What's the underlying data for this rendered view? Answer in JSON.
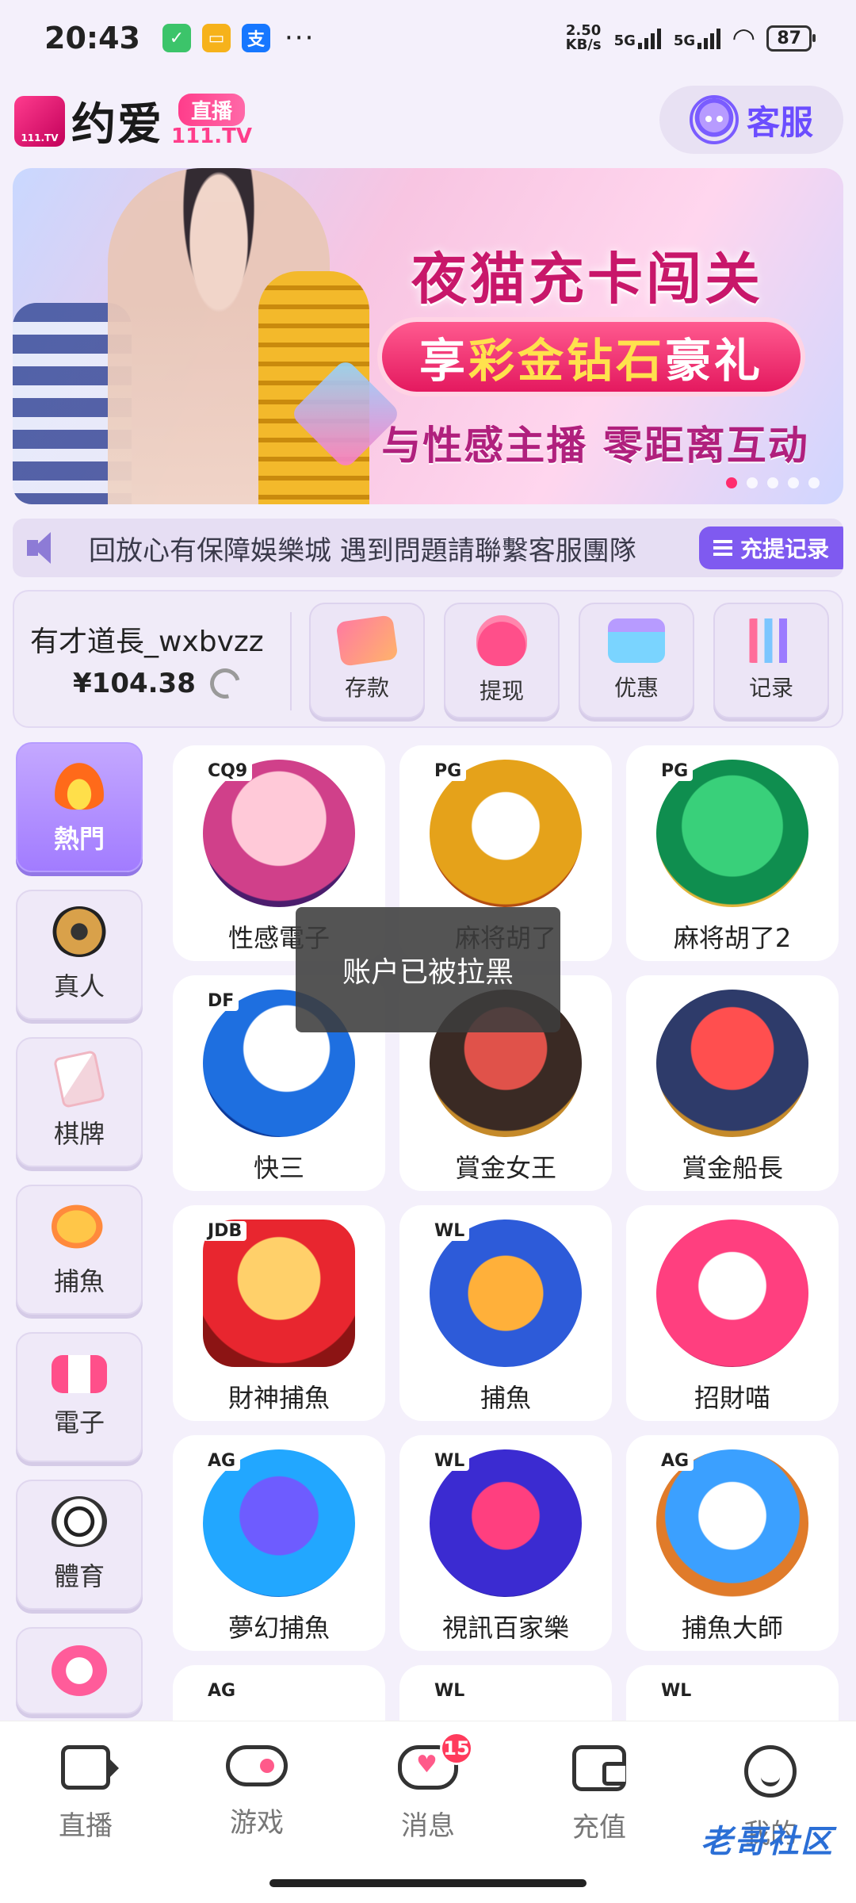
{
  "status_bar": {
    "time": "20:43",
    "dots": "···",
    "speed_value": "2.50",
    "speed_unit": "KB/s",
    "net1": "5G",
    "net2": "5G",
    "battery": "87"
  },
  "header": {
    "logo_text": "约爱",
    "logo_mark_text": "111.TV",
    "live_tag": "直播",
    "tv_text": "111.TV",
    "customer_service": "客服"
  },
  "banner": {
    "title": "夜猫充卡闯关",
    "pill_prefix": "享",
    "pill_highlight": "彩金钻石",
    "pill_suffix": "豪礼",
    "subtitle": "与性感主播 零距离互动",
    "slide_count": 5,
    "active_slide": 1
  },
  "marquee": {
    "text": "回放心有保障娛樂城  遇到問題請聯繫客服團隊  ",
    "record_button": "充提记录"
  },
  "account": {
    "username": "有才道長_wxbvzz",
    "balance": "¥104.38",
    "actions": [
      "存款",
      "提现",
      "优惠",
      "记录"
    ]
  },
  "categories": [
    {
      "label": "熱門",
      "active": true
    },
    {
      "label": "真人",
      "active": false
    },
    {
      "label": "棋牌",
      "active": false
    },
    {
      "label": "捕魚",
      "active": false
    },
    {
      "label": "電子",
      "active": false
    },
    {
      "label": "體育",
      "active": false
    },
    {
      "label": "",
      "active": false
    }
  ],
  "games": [
    {
      "name": "性感電子",
      "provider": "CQ9"
    },
    {
      "name": "麻将胡了",
      "provider": "PG"
    },
    {
      "name": "麻将胡了2",
      "provider": "PG"
    },
    {
      "name": "快三",
      "provider": "DF"
    },
    {
      "name": "賞金女王",
      "provider": ""
    },
    {
      "name": "賞金船長",
      "provider": ""
    },
    {
      "name": "財神捕魚",
      "provider": "JDB"
    },
    {
      "name": "捕魚",
      "provider": "WL"
    },
    {
      "name": "招財喵",
      "provider": ""
    },
    {
      "name": "夢幻捕魚",
      "provider": "AG"
    },
    {
      "name": "視訊百家樂",
      "provider": "WL"
    },
    {
      "name": "捕魚大師",
      "provider": "AG"
    },
    {
      "name": "",
      "provider": "AG"
    },
    {
      "name": "",
      "provider": "WL"
    },
    {
      "name": "",
      "provider": "WL"
    }
  ],
  "toast": "账户已被拉黑",
  "bottom_nav": [
    {
      "label": "直播",
      "icon": "camera-icon"
    },
    {
      "label": "游戏",
      "icon": "gamepad-icon"
    },
    {
      "label": "消息",
      "icon": "message-icon",
      "badge": "15"
    },
    {
      "label": "充值",
      "icon": "wallet-icon"
    },
    {
      "label": "我的",
      "icon": "profile-icon"
    }
  ],
  "watermark": "老哥社区"
}
